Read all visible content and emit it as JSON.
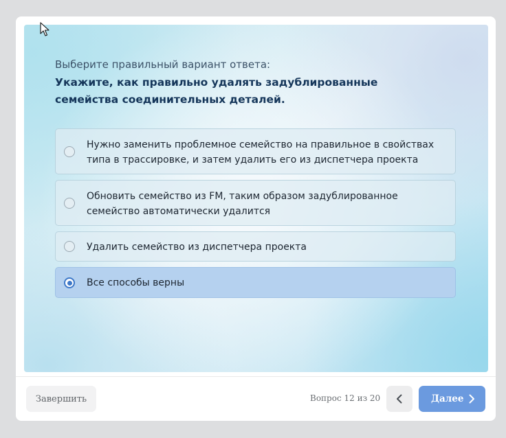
{
  "quiz": {
    "prompt": "Выберите правильный вариант ответа:",
    "question": "Укажите, как правильно удалять задублированные семейства соединительных деталей.",
    "options": [
      {
        "label": "Нужно заменить проблемное семейство на правильное в свойствах типа в трассировке, и затем удалить его из диспетчера проекта",
        "selected": false
      },
      {
        "label": "Обновить семейство из FM, таким образом задублированное семейство автоматически удалится",
        "selected": false
      },
      {
        "label": "Удалить семейство из диспетчера проекта",
        "selected": false
      },
      {
        "label": "Все способы верны",
        "selected": true
      }
    ]
  },
  "footer": {
    "finish_label": "Завершить",
    "progress_text": "Вопрос 12 из 20",
    "next_label": "Далее"
  },
  "icons": {
    "radio": "radio-button-icon",
    "prev": "chevron-left-icon",
    "next": "chevron-right-icon",
    "cursor": "mouse-pointer-icon"
  },
  "colors": {
    "accent": "#6b9adf",
    "selected_option": "#b5d1ef",
    "question_text": "#15365a"
  }
}
